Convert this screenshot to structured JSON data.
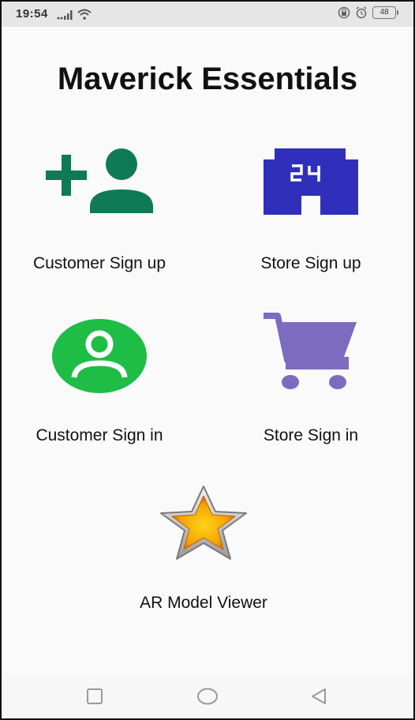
{
  "status_bar": {
    "time": "19:54",
    "battery": "48"
  },
  "app": {
    "title": "Maverick Essentials"
  },
  "tiles": {
    "customer_signup": {
      "label": "Customer Sign up",
      "icon": "person-add-icon",
      "color": "#0f7a55"
    },
    "store_signup": {
      "label": "Store Sign up",
      "icon": "store-24-icon",
      "color": "#2f2fbb"
    },
    "customer_signin": {
      "label": "Customer Sign in",
      "icon": "account-circle-icon",
      "color": "#1ebd46"
    },
    "store_signin": {
      "label": "Store Sign in",
      "icon": "shopping-cart-icon",
      "color": "#7b6cbf"
    },
    "ar_viewer": {
      "label": "AR Model Viewer",
      "icon": "star-icon",
      "color": "#f5a300"
    }
  },
  "nav": {
    "recent": "square-icon",
    "home": "circle-icon",
    "back": "triangle-back-icon"
  }
}
